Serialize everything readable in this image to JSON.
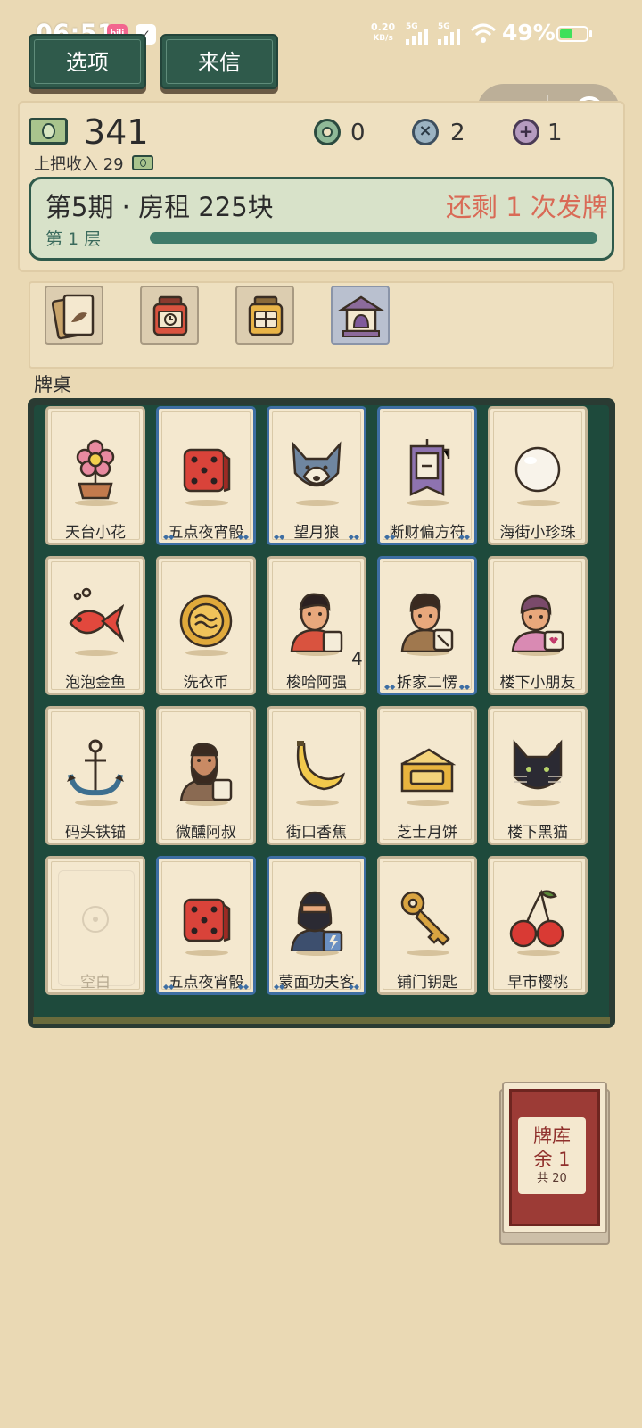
{
  "status_bar": {
    "time": "06:51",
    "net_speed_value": "0.20",
    "net_speed_unit": "KB/s",
    "signal_1": "5G",
    "signal_2": "5G",
    "battery_percent": "49%",
    "battery_level": 0.49
  },
  "top_buttons": {
    "options": "选项",
    "letters": "来信"
  },
  "stats": {
    "money": "341",
    "last_income_label": "上把收入",
    "last_income_value": "29",
    "green_tokens": "0",
    "remove_tokens": "2",
    "add_tokens": "1"
  },
  "rent": {
    "title": "第5期 · 房租 225块",
    "remaining": "还剩 1 次发牌",
    "floor": "第 1 层",
    "progress": 1.0
  },
  "items": [
    {
      "name": "card-pack-icon"
    },
    {
      "name": "clock-jar-icon"
    },
    {
      "name": "gift-jar-icon"
    },
    {
      "name": "shrine-icon"
    }
  ],
  "board": {
    "label": "牌桌",
    "cards": [
      {
        "name": "天台小花",
        "icon": "flower-pot",
        "rare": false,
        "count": ""
      },
      {
        "name": "五点夜宵骰",
        "icon": "dice",
        "rare": true,
        "count": ""
      },
      {
        "name": "望月狼",
        "icon": "wolf",
        "rare": true,
        "count": ""
      },
      {
        "name": "断财偏方符",
        "icon": "talisman",
        "rare": true,
        "count": ""
      },
      {
        "name": "海街小珍珠",
        "icon": "pearl",
        "rare": false,
        "count": ""
      },
      {
        "name": "泡泡金鱼",
        "icon": "goldfish",
        "rare": false,
        "count": ""
      },
      {
        "name": "洗衣币",
        "icon": "coin",
        "rare": false,
        "count": ""
      },
      {
        "name": "梭哈阿强",
        "icon": "man-dice",
        "rare": false,
        "count": "4"
      },
      {
        "name": "拆家二愣",
        "icon": "man-tool",
        "rare": true,
        "count": ""
      },
      {
        "name": "楼下小朋友",
        "icon": "kid",
        "rare": false,
        "count": ""
      },
      {
        "name": "码头铁锚",
        "icon": "anchor",
        "rare": false,
        "count": ""
      },
      {
        "name": "微醺阿叔",
        "icon": "uncle",
        "rare": false,
        "count": ""
      },
      {
        "name": "街口香蕉",
        "icon": "banana",
        "rare": false,
        "count": ""
      },
      {
        "name": "芝士月饼",
        "icon": "cheese",
        "rare": false,
        "count": ""
      },
      {
        "name": "楼下黑猫",
        "icon": "black-cat",
        "rare": false,
        "count": ""
      },
      {
        "name": "空白",
        "icon": "empty",
        "rare": false,
        "count": ""
      },
      {
        "name": "五点夜宵骰",
        "icon": "dice",
        "rare": true,
        "count": ""
      },
      {
        "name": "蒙面功夫客",
        "icon": "ninja",
        "rare": true,
        "count": ""
      },
      {
        "name": "铺门钥匙",
        "icon": "key",
        "rare": false,
        "count": ""
      },
      {
        "name": "早市樱桃",
        "icon": "cherry",
        "rare": false,
        "count": ""
      }
    ]
  },
  "deck": {
    "line1": "牌库",
    "line2": "余 1",
    "line3": "共 20"
  }
}
